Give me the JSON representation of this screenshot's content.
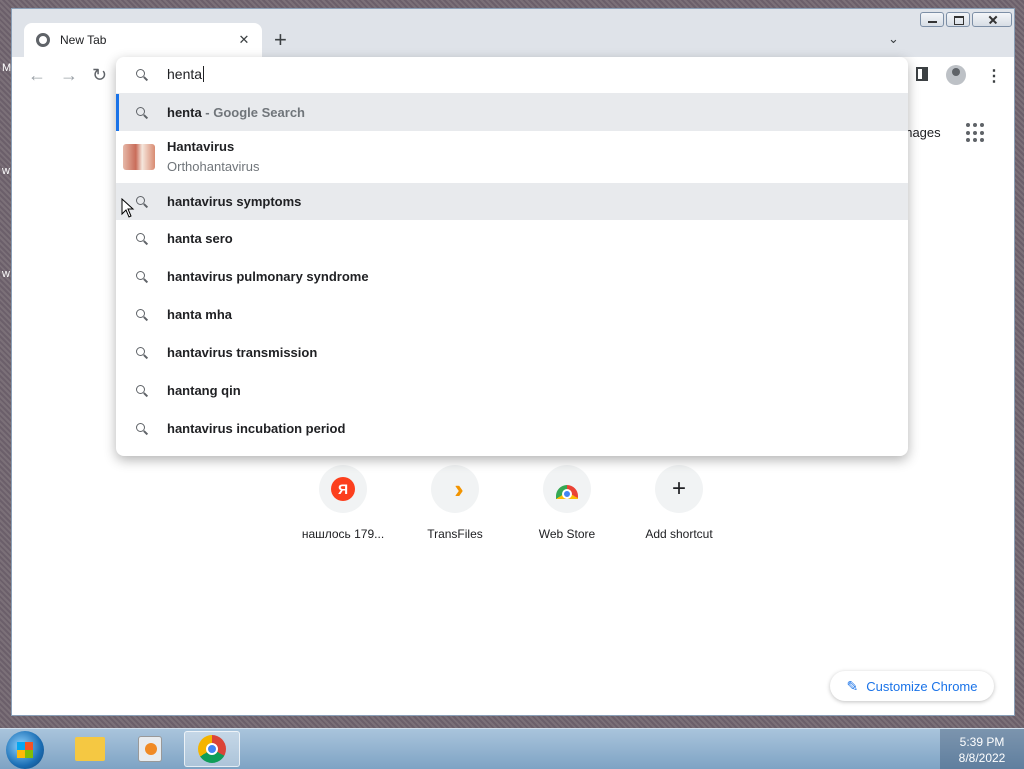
{
  "desktop": {
    "side_letters": [
      "M",
      "w",
      "w"
    ]
  },
  "tab": {
    "title": "New Tab"
  },
  "omnibox": {
    "input_value": "henta",
    "suggestions": [
      {
        "text": "henta",
        "suffix": "- Google Search"
      },
      {
        "title": "Hantavirus",
        "subtitle": "Orthohantavirus"
      },
      {
        "text": "hantavirus symptoms"
      },
      {
        "text": "hanta sero"
      },
      {
        "text": "hantavirus pulmonary syndrome"
      },
      {
        "text": "hanta mha"
      },
      {
        "text": "hantavirus transmission"
      },
      {
        "text": "hantang qin"
      },
      {
        "text": "hantavirus incubation period"
      }
    ]
  },
  "ntp": {
    "images_link": "Images",
    "shortcuts": [
      {
        "label": "нашлось 179...",
        "icon": "Я"
      },
      {
        "label": "TransFiles"
      },
      {
        "label": "Web Store"
      },
      {
        "label": "Add shortcut",
        "icon": "+"
      }
    ],
    "customize_label": "Customize Chrome"
  },
  "taskbar": {
    "time": "5:39 PM",
    "date": "8/8/2022"
  }
}
